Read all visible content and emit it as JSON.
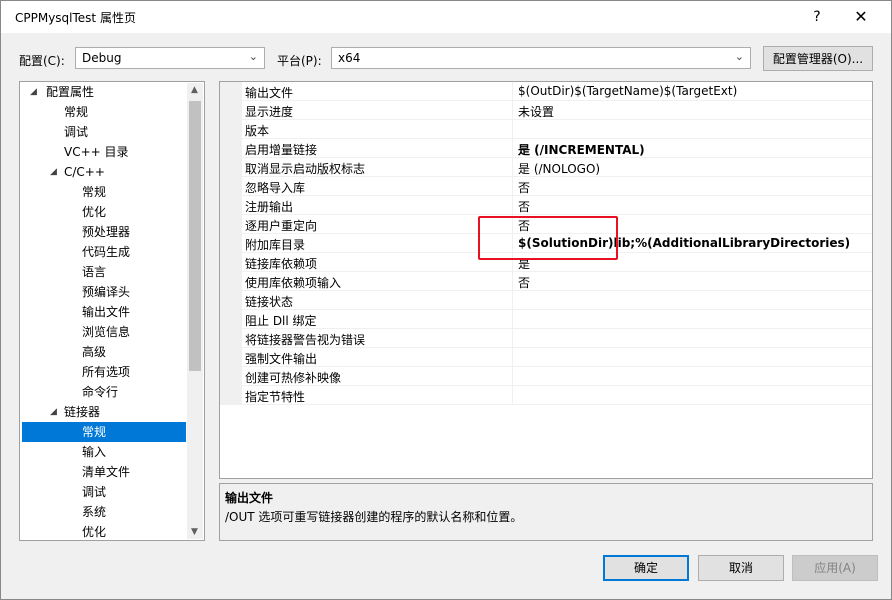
{
  "window": {
    "title": "CPPMysqlTest 属性页",
    "help": "?",
    "close": "✕"
  },
  "toolbar": {
    "config_label": "配置(C):",
    "config_value": "Debug",
    "platform_label": "平台(P):",
    "platform_value": "x64",
    "config_manager": "配置管理器(O)..."
  },
  "tree": {
    "items": [
      {
        "label": "配置属性"
      },
      {
        "label": "常规"
      },
      {
        "label": "调试"
      },
      {
        "label": "VC++ 目录"
      },
      {
        "label": "C/C++"
      },
      {
        "label": "常规"
      },
      {
        "label": "优化"
      },
      {
        "label": "预处理器"
      },
      {
        "label": "代码生成"
      },
      {
        "label": "语言"
      },
      {
        "label": "预编译头"
      },
      {
        "label": "输出文件"
      },
      {
        "label": "浏览信息"
      },
      {
        "label": "高级"
      },
      {
        "label": "所有选项"
      },
      {
        "label": "命令行"
      },
      {
        "label": "链接器"
      },
      {
        "label": "常规"
      },
      {
        "label": "输入"
      },
      {
        "label": "清单文件"
      },
      {
        "label": "调试"
      },
      {
        "label": "系统"
      },
      {
        "label": "优化"
      }
    ],
    "selected_index": 17
  },
  "properties": {
    "rows": [
      {
        "name": "输出文件",
        "value": "$(OutDir)$(TargetName)$(TargetExt)"
      },
      {
        "name": "显示进度",
        "value": "未设置"
      },
      {
        "name": "版本",
        "value": ""
      },
      {
        "name": "启用增量链接",
        "value": "是 (/INCREMENTAL)"
      },
      {
        "name": "取消显示启动版权标志",
        "value": "是 (/NOLOGO)"
      },
      {
        "name": "忽略导入库",
        "value": "否"
      },
      {
        "name": "注册输出",
        "value": "否"
      },
      {
        "name": "逐用户重定向",
        "value": "否"
      },
      {
        "name": "附加库目录",
        "value": "$(SolutionDir)lib;%(AdditionalLibraryDirectories)"
      },
      {
        "name": "链接库依赖项",
        "value": "是"
      },
      {
        "name": "使用库依赖项输入",
        "value": "否"
      },
      {
        "name": "链接状态",
        "value": ""
      },
      {
        "name": "阻止 Dll 绑定",
        "value": ""
      },
      {
        "name": "将链接器警告视为错误",
        "value": ""
      },
      {
        "name": "强制文件输出",
        "value": ""
      },
      {
        "name": "创建可热修补映像",
        "value": ""
      },
      {
        "name": "指定节特性",
        "value": ""
      }
    ]
  },
  "description": {
    "title": "输出文件",
    "text": "/OUT 选项可重写链接器创建的程序的默认名称和位置。"
  },
  "buttons": {
    "ok": "确定",
    "cancel": "取消",
    "apply": "应用(A)"
  },
  "colors": {
    "selection": "#0078d7",
    "highlight_box": "#e81123"
  }
}
